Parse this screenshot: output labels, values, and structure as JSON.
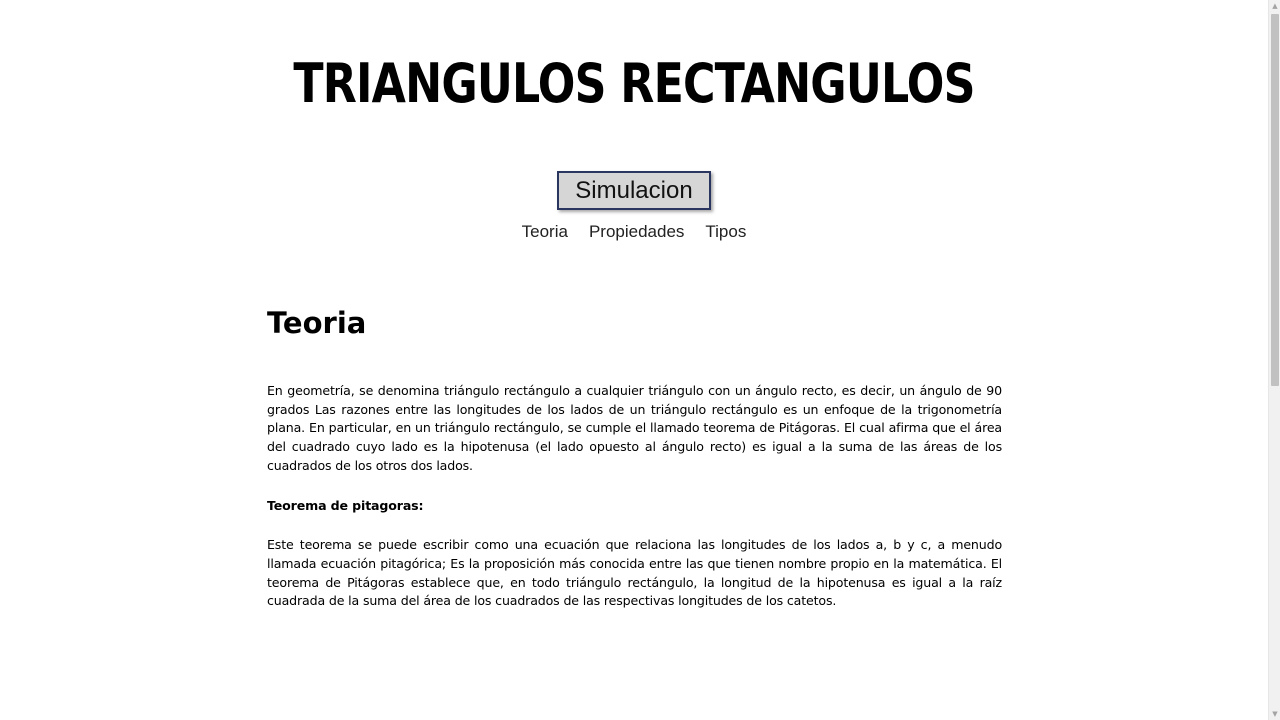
{
  "header": {
    "title": "TRIANGULOS RECTANGULOS"
  },
  "simulation_button": {
    "label": "Simulacion"
  },
  "nav": {
    "items": [
      {
        "label": "Teoria"
      },
      {
        "label": "Propiedades"
      },
      {
        "label": "Tipos"
      }
    ]
  },
  "section": {
    "heading": "Teoria",
    "paragraph1": "En geometría, se denomina triángulo rectángulo a cualquier triángulo con un ángulo recto, es decir, un ángulo de 90 grados Las razones entre las longitudes de los lados de un triángulo rectángulo es un enfoque de la trigonometría plana. En particular, en un triángulo rectángulo, se cumple el llamado teorema de Pitágoras. El cual afirma que el área del cuadrado cuyo lado es la hipotenusa (el lado opuesto al ángulo recto) es igual a la suma de las áreas de los cuadrados de los otros dos lados.",
    "subtitle": "Teorema de pitagoras:",
    "paragraph2": "Este teorema se puede escribir como una ecuación que relaciona las longitudes de los lados a, b y c, a menudo llamada ecuación pitagórica; Es la proposición más conocida entre las que tienen nombre propio en la matemática. El teorema de Pitágoras establece que, en todo triángulo rectángulo, la longitud de la hipotenusa es igual a la raíz cuadrada de la suma del área de los cuadrados de las respectivas longitudes de los catetos."
  },
  "scrollbar": {
    "up_icon": "triangle-up-icon",
    "down_icon": "triangle-down-icon"
  }
}
